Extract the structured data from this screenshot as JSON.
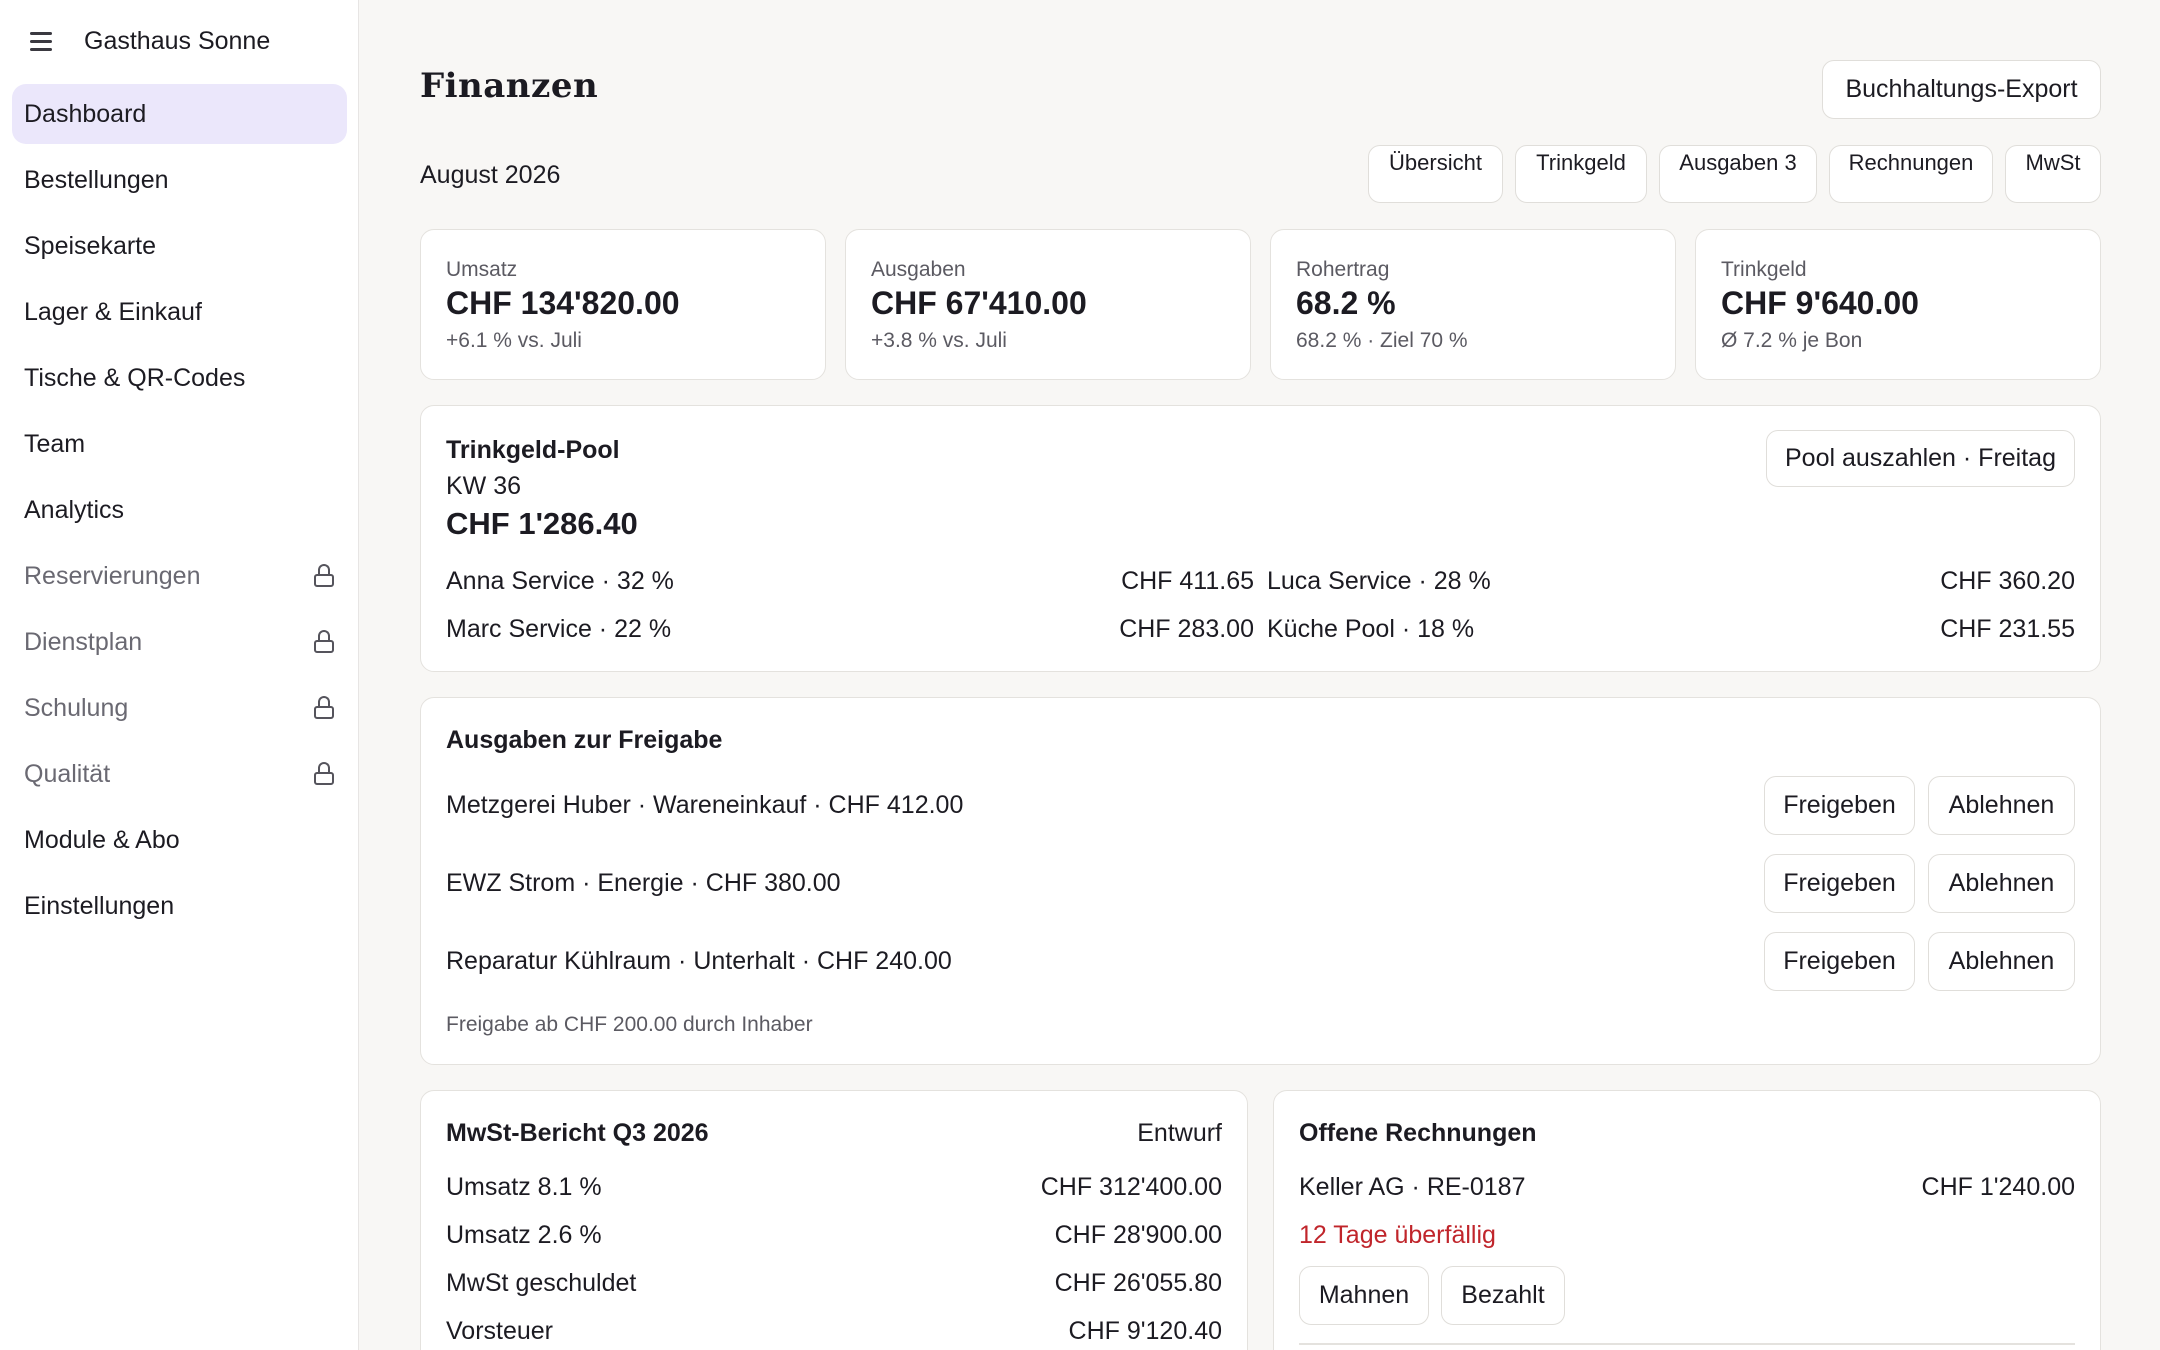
{
  "app": {
    "name": "Gasthaus Sonne"
  },
  "sidebar": {
    "items": [
      {
        "label": "Dashboard"
      },
      {
        "label": "Bestellungen"
      },
      {
        "label": "Speisekarte"
      },
      {
        "label": "Lager & Einkauf"
      },
      {
        "label": "Tische & QR-Codes"
      },
      {
        "label": "Team"
      },
      {
        "label": "Analytics"
      },
      {
        "label": "Reservierungen"
      },
      {
        "label": "Dienstplan"
      },
      {
        "label": "Schulung"
      },
      {
        "label": "Qualität"
      },
      {
        "label": "Module & Abo"
      },
      {
        "label": "Einstellungen"
      }
    ]
  },
  "header": {
    "title": "Finanzen",
    "export_label": "Buchhaltungs-Export",
    "period": "August 2026",
    "tabs": [
      {
        "label": "Übersicht"
      },
      {
        "label": "Trinkgeld"
      },
      {
        "label": "Ausgaben 3"
      },
      {
        "label": "Rechnungen"
      },
      {
        "label": "MwSt"
      }
    ]
  },
  "kpis": [
    {
      "label": "Umsatz",
      "value": "CHF 134'820.00",
      "sub": "+6.1 % vs. Juli"
    },
    {
      "label": "Ausgaben",
      "value": "CHF 67'410.00",
      "sub": "+3.8 % vs. Juli"
    },
    {
      "label": "Rohertrag",
      "value": "68.2 %",
      "sub": "68.2 % · Ziel 70 %"
    },
    {
      "label": "Trinkgeld",
      "value": "CHF 9'640.00",
      "sub": "Ø 7.2 % je Bon"
    }
  ],
  "tip_pool": {
    "title": "Trinkgeld-Pool",
    "week": "KW 36",
    "total": "CHF 1'286.40",
    "payout_label": "Pool auszahlen · Freitag",
    "shares": [
      {
        "name": "Anna Service · 32 %",
        "amount": "CHF 411.65"
      },
      {
        "name": "Luca Service · 28 %",
        "amount": "CHF 360.20"
      },
      {
        "name": "Marc Service · 22 %",
        "amount": "CHF 283.00"
      },
      {
        "name": "Küche Pool · 18 %",
        "amount": "CHF 231.55"
      }
    ]
  },
  "approvals": {
    "title": "Ausgaben zur Freigabe",
    "approve_label": "Freigeben",
    "reject_label": "Ablehnen",
    "items": [
      {
        "text": "Metzgerei Huber · Wareneinkauf · CHF 412.00"
      },
      {
        "text": "EWZ Strom · Energie · CHF 380.00"
      },
      {
        "text": "Reparatur Kühlraum · Unterhalt · CHF 240.00"
      }
    ],
    "note": "Freigabe ab CHF 200.00 durch Inhaber"
  },
  "vat_report": {
    "title": "MwSt-Bericht Q3 2026",
    "status": "Entwurf",
    "rows": [
      {
        "label": "Umsatz 8.1 %",
        "value": "CHF 312'400.00"
      },
      {
        "label": "Umsatz 2.6 %",
        "value": "CHF 28'900.00"
      },
      {
        "label": "MwSt geschuldet",
        "value": "CHF 26'055.80"
      },
      {
        "label": "Vorsteuer",
        "value": "CHF 9'120.40"
      }
    ]
  },
  "open_invoices": {
    "title": "Offene Rechnungen",
    "items": [
      {
        "customer": "Keller AG · RE-0187",
        "amount": "CHF 1'240.00",
        "status": "12 Tage überfällig",
        "remind_label": "Mahnen",
        "paid_label": "Bezahlt"
      }
    ]
  },
  "colors": {
    "accent_bg": "#ebe7fb",
    "overdue": "#c0252b"
  }
}
